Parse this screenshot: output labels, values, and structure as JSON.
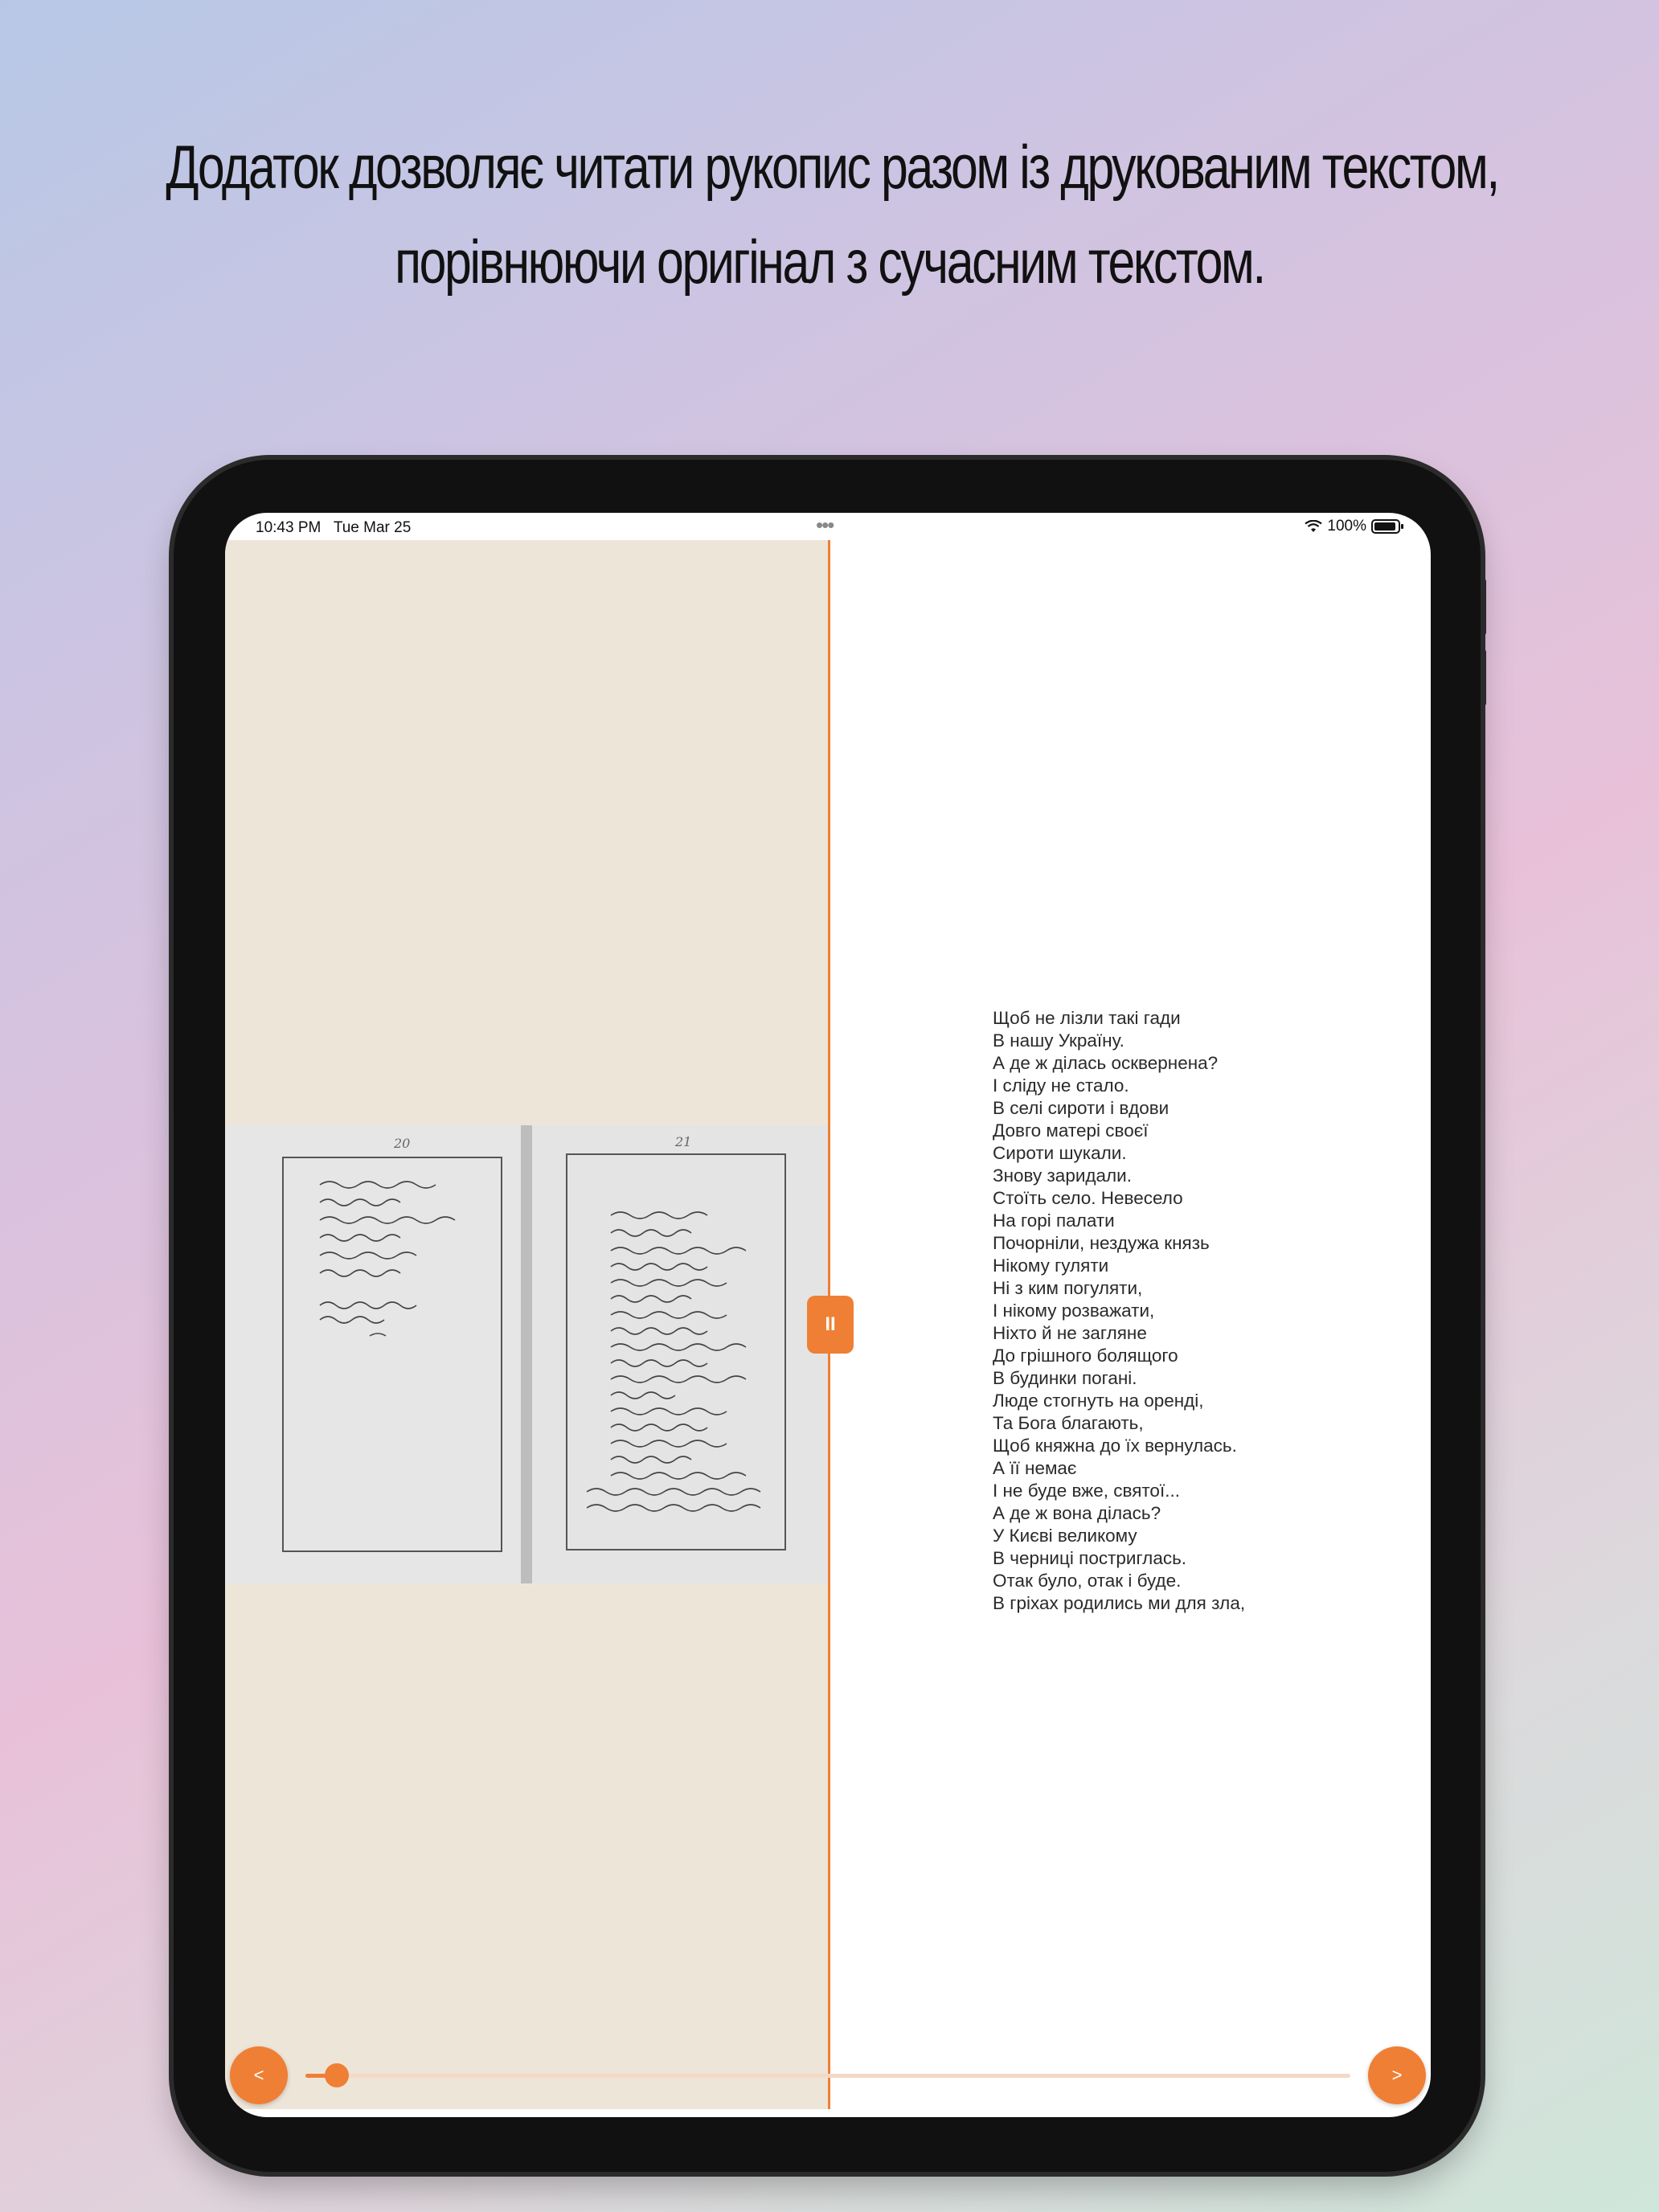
{
  "headline": {
    "line1": "Додаток дозволяє читати рукопис разом із друкованим текстом,",
    "line2": "порівнюючи оригінал з сучасним текстом."
  },
  "status_bar": {
    "time": "10:43 PM",
    "date": "Tue Mar 25",
    "multitask_dots": "•••",
    "battery": "100%",
    "wifi_icon": "wifi-icon",
    "battery_icon": "battery-icon"
  },
  "manuscript": {
    "left_page_number": "20",
    "right_page_number": "21"
  },
  "divider_handle": {
    "label": "II",
    "icon": "pause-icon"
  },
  "poem_lines": [
    "Щоб не лізли такі гади",
    "В нашу Україну.",
    "А де ж ділась осквернена?",
    "І сліду не стало.",
    "В селі сироти і вдови",
    "Довго матері своєї",
    "Сироти шукали.",
    "Знову заридали.",
    "Стоїть село. Невесело",
    "На горі палати",
    "Почорніли, нездужа князь",
    "Нікому гуляти",
    "Ні з ким погуляти,",
    "І нікому розважати,",
    "Ніхто й не загляне",
    "До грішного болящого",
    "В будинки погані.",
    "Люде стогнуть на оренді,",
    "Та Бога благають,",
    "Щоб княжна до їх вернулась.",
    "А її немає",
    "І не буде вже, святої...",
    "А де ж вона ділась?",
    "У Києві великому",
    "В черниці постриглась.",
    "Отак було, отак і буде.",
    "В гріхах родились ми для зла,"
  ],
  "navigation": {
    "prev_label": "<",
    "next_label": ">",
    "progress_fraction": 0.03
  },
  "colors": {
    "accent": "#ef7f34",
    "manuscript_bg": "#eee5d9"
  }
}
